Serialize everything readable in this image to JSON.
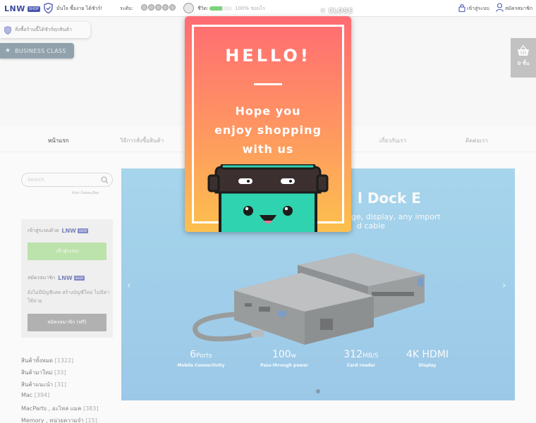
{
  "topbar": {
    "logo": "LNW",
    "logo_tag": "SHOP",
    "trust_text": "มั่นใจ ซื้อง่าย ได้ชัวร์!",
    "rating_label": "ระดับ:",
    "points_label": "ชีวิต:",
    "points_value": "100% ชอบไร",
    "points_level": 0.55,
    "login_link": "เข้าสู่ระบบ",
    "register_link": "สมัครสมาชิก"
  },
  "badges": {
    "guarantee": "สั่งซื้อร้านนี้ได้ชัวร์ทุกสินค้า",
    "business": "BUSINESS CLASS"
  },
  "cart": {
    "count": "0 ชิ้น"
  },
  "nav": {
    "items": [
      "หน้าแรก",
      "วิธีการสั่งซื้อสินค้า",
      "เกี่ยวกับเรา",
      "ติดต่อเรา"
    ]
  },
  "sidebar": {
    "search_placeholder": "Search",
    "advanced_search": "ค้นหาโดยละเอียด",
    "login_with": "เข้าสู่ระบบด้วย",
    "login_button": "เข้าสู่ระบบ",
    "register_heading": "สมัครสมาชิก",
    "register_desc": "ยังไม่มีบัญชีเทพ สร้างบัญชีใหม่ ไม่มีค่าใช้จ่าย",
    "register_button": "สมัครสมาชิก (ฟรี)",
    "categories": [
      {
        "name": "สินค้าทั้งหมด",
        "count": "[1322]"
      },
      {
        "name": "สินค้ามาใหม่",
        "count": "[33]"
      },
      {
        "name": "สินค้าแนะนำ",
        "count": "[31]"
      },
      {
        "name": "Mac",
        "count": "[394]"
      },
      {
        "name": "MacParts , อะไหล่ แมค",
        "count": "[383]"
      },
      {
        "name": "Memory , หน่วยความจำ",
        "count": "[15]"
      }
    ]
  },
  "banner": {
    "title": "l Dock E",
    "subtitle_line1": "ge, display, any import",
    "subtitle_line2": "d cable",
    "specs": [
      {
        "big": "6",
        "unit": "Ports",
        "label": "Mobile Connectivity"
      },
      {
        "big": "100",
        "unit": "w",
        "label": "Pass-through power"
      },
      {
        "big": "312",
        "unit": "MB/S",
        "label": "Card reader"
      },
      {
        "big": "4K HDMI",
        "unit": "",
        "label": "Display"
      }
    ]
  },
  "popup": {
    "close_label": "CLOSE",
    "hello": "HELLO!",
    "message_line1": "Hope you",
    "message_line2": "enjoy shopping",
    "message_line3": "with us"
  },
  "colors": {
    "brand": "#3c4a9e",
    "login_green": "#9fdc86",
    "banner_blue": "#7ec6ea",
    "popup_top": "#ff6b73",
    "popup_bottom": "#fcc04d"
  }
}
